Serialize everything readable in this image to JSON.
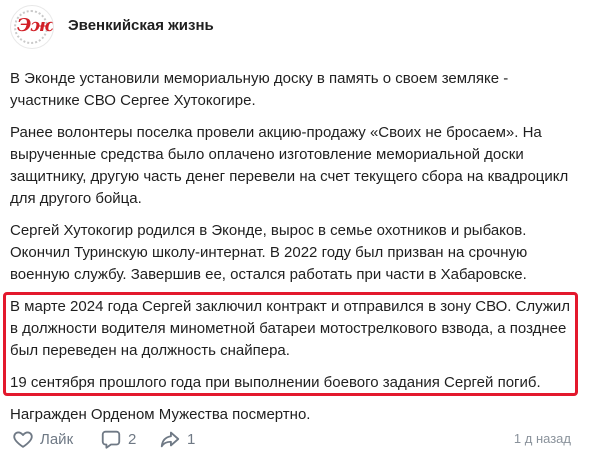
{
  "header": {
    "avatar_text": "Эж",
    "group_name": "Эвенкийская жизнь"
  },
  "post": {
    "paragraphs": [
      "В Эконде установили мемориальную доску в память о своем земляке - участнике СВО Сергее Хутокогире.",
      "Ранее волонтеры поселка провели акцию-продажу «Своих не бросаем». На вырученные средства было оплачено изготовление мемориальной доски защитнику, другую часть денег перевели на счет текущего сбора на квадроцикл для другого бойца.",
      "Сергей Хутокогир родился в Эконде, вырос в семье охотников и рыбаков. Окончил Туринскую школу-интернат. В 2022 году был призван на срочную военную службу. Завершив ее, остался работать при части в Хабаровске.",
      "В марте 2024 года Сергей заключил контракт и отправился в зону СВО. Служил в должности водителя минометной батареи мотострелкового взвода, а позднее был переведен на должность снайпера.",
      "19 сентября прошлого года при выполнении боевого задания Сергей погиб.",
      "Награжден Орденом Мужества посмертно."
    ]
  },
  "footer": {
    "like_label": "Лайк",
    "comments_count": "2",
    "shares_count": "1",
    "timestamp": "1 д назад"
  },
  "colors": {
    "highlight_border": "#e3182d",
    "icon_gray": "#6f7985",
    "avatar_red": "#d11f26"
  }
}
